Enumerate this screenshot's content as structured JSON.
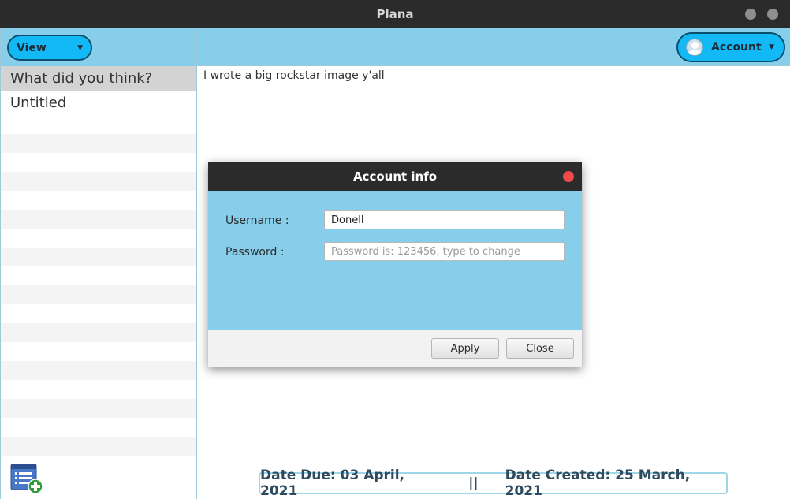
{
  "window": {
    "title": "Plana"
  },
  "sidebar": {
    "view_button": "View",
    "notes": [
      {
        "label": "What did you think?",
        "selected": true
      },
      {
        "label": "Untitled",
        "selected": false
      }
    ],
    "add_note_icon": "add-note-icon"
  },
  "header": {
    "account_button": "Account"
  },
  "editor": {
    "text": "I wrote a big rockstar image y'all"
  },
  "footer": {
    "date_due": "Date Due: 03 April, 2021",
    "separator": "||",
    "date_created": "Date Created: 25 March, 2021"
  },
  "dialog": {
    "title": "Account info",
    "username_label": "Username :",
    "username_value": "Donell",
    "password_label": "Password :",
    "password_placeholder": "Password is: 123456, type to change",
    "apply_label": "Apply",
    "close_label": "Close"
  },
  "colors": {
    "accent": "#87ceeb",
    "button": "#13b9f5",
    "titlebar": "#2b2b2b",
    "close_dot": "#ef4a4a"
  }
}
